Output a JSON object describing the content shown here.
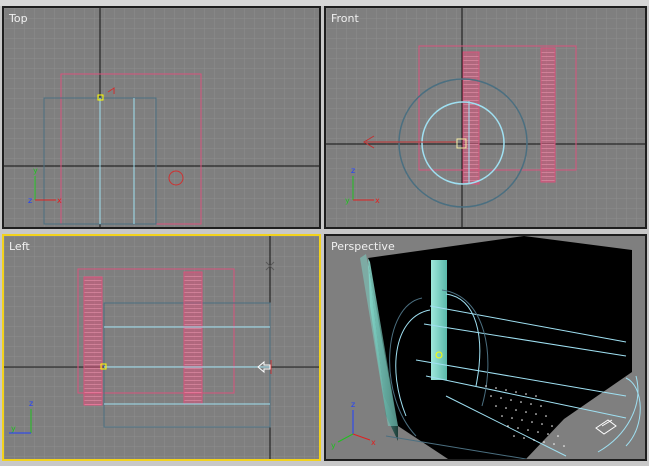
{
  "viewports": {
    "top": {
      "label": "Top"
    },
    "front": {
      "label": "Front"
    },
    "left": {
      "label": "Left"
    },
    "perspective": {
      "label": "Perspective"
    }
  },
  "colors": {
    "viewport_bg": "#7f7f7f",
    "grid": "#8e8e8e",
    "grid_major": "#9a9a9a",
    "axis_line": "#111111",
    "object_pink": "#d8537c",
    "object_cyan": "#9fe0f2",
    "object_teal": "#4b6f80",
    "active_border": "#f2d21c",
    "axis_x": "#e02020",
    "axis_y": "#20c020",
    "axis_z": "#2040ff"
  },
  "axes": {
    "x": "x",
    "y": "y",
    "z": "z"
  }
}
